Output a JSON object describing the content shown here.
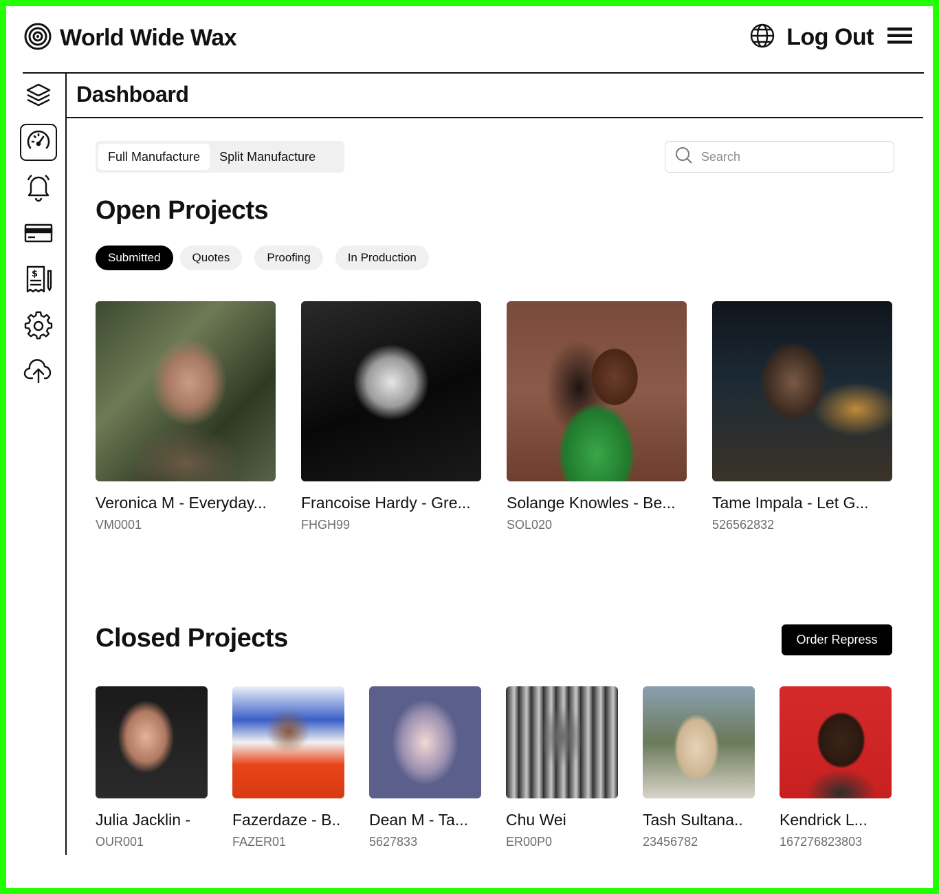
{
  "brand": {
    "name": "World Wide Wax",
    "icon": "target-logo-icon"
  },
  "header": {
    "logout_label": "Log Out",
    "globe_icon": "globe-icon",
    "menu_icon": "hamburger-menu-icon"
  },
  "sidebar": {
    "items": [
      {
        "name": "layers",
        "icon": "layers-icon",
        "active": false
      },
      {
        "name": "dashboard",
        "icon": "speedometer-icon",
        "active": true
      },
      {
        "name": "notifications",
        "icon": "bell-icon",
        "active": false
      },
      {
        "name": "payments",
        "icon": "credit-card-icon",
        "active": false
      },
      {
        "name": "invoices",
        "icon": "invoice-icon",
        "active": false
      },
      {
        "name": "settings",
        "icon": "gear-icon",
        "active": false
      },
      {
        "name": "upload",
        "icon": "cloud-upload-icon",
        "active": false
      }
    ]
  },
  "page": {
    "title": "Dashboard"
  },
  "manufacture_toggle": {
    "options": [
      "Full Manufacture",
      "Split Manufacture"
    ],
    "selected": "Full Manufacture"
  },
  "search": {
    "placeholder": "Search",
    "value": ""
  },
  "open_projects": {
    "title": "Open Projects",
    "filters": [
      "Submitted",
      "Quotes",
      "Proofing",
      "In Production"
    ],
    "selected_filter": "Submitted",
    "items": [
      {
        "title": "Veronica M - Everyday...",
        "code": "VM0001"
      },
      {
        "title": "Francoise Hardy - Gre...",
        "code": "FHGH99"
      },
      {
        "title": "Solange Knowles - Be...",
        "code": "SOL020"
      },
      {
        "title": "Tame Impala - Let G...",
        "code": "526562832"
      }
    ]
  },
  "closed_projects": {
    "title": "Closed Projects",
    "action_label": "Order Repress",
    "items": [
      {
        "title": "Julia Jacklin -",
        "code": "OUR001"
      },
      {
        "title": "Fazerdaze - B..",
        "code": "FAZER01"
      },
      {
        "title": "Dean M - Ta...",
        "code": "5627833"
      },
      {
        "title": "Chu Wei",
        "code": "ER00P0"
      },
      {
        "title": "Tash Sultana..",
        "code": "23456782"
      },
      {
        "title": "Kendrick L...",
        "code": "167276823803"
      }
    ]
  },
  "colors": {
    "frame_border": "#22ff00",
    "accent": "#000000",
    "pill_bg": "#f0f0f0",
    "muted_text": "#6e6e6e"
  }
}
